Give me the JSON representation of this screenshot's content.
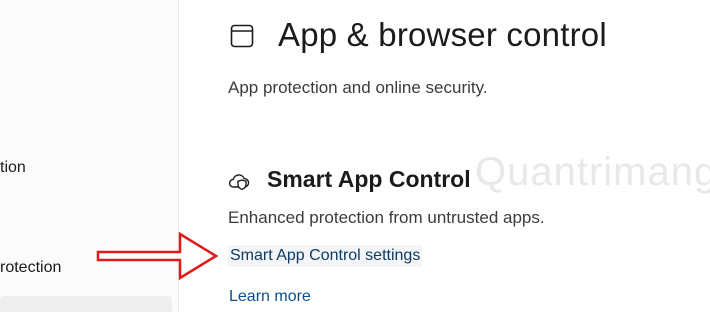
{
  "sidebar": {
    "items": [
      {
        "label": "tion"
      },
      {
        "label": "rotection"
      }
    ]
  },
  "main": {
    "title": "App & browser control",
    "subtitle": "App protection and online security.",
    "title_icon": "window-icon",
    "section": {
      "icon": "shield-cloud-icon",
      "title": "Smart App Control",
      "description": "Enhanced protection from untrusted apps.",
      "settings_link": "Smart App Control settings",
      "learn_more_link": "Learn more"
    }
  },
  "annotation": {
    "arrow_color": "#e01a1a",
    "watermark_text": "Quantrimang"
  },
  "colors": {
    "link": "#0e3a64",
    "text": "#1b1b1b",
    "secondary_text": "#3b3b3b"
  }
}
